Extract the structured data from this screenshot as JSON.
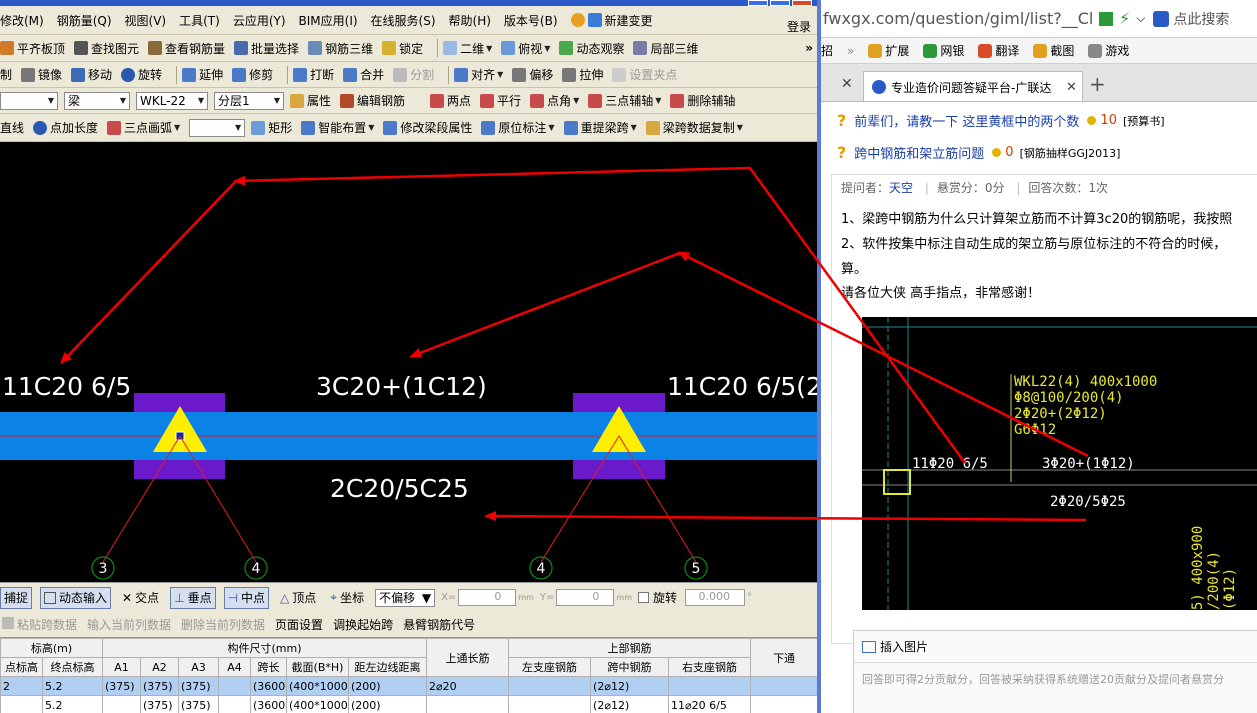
{
  "window": {
    "login": "登录"
  },
  "menu": [
    "修改(M)",
    "钢筋量(Q)",
    "视图(V)",
    "工具(T)",
    "云应用(Y)",
    "BIM应用(I)",
    "在线服务(S)",
    "帮助(H)",
    "版本号(B)",
    "新建变更"
  ],
  "toolbar1": [
    "平齐板顶",
    "查找图元",
    "查看钢筋量",
    "批量选择",
    "钢筋三维",
    "锁定",
    "二维",
    "俯视",
    "动态观察",
    "局部三维"
  ],
  "toolbar2": [
    "制",
    "镜像",
    "移动",
    "旋转",
    "延伸",
    "修剪",
    "打断",
    "合并",
    "分割",
    "对齐",
    "偏移",
    "拉伸",
    "设置夹点"
  ],
  "toolbar3": {
    "type": "梁",
    "member": "WKL-22",
    "layer": "分层1",
    "props": "属性",
    "edit": "编辑钢筋",
    "items": [
      "两点",
      "平行",
      "点角",
      "三点辅轴",
      "删除辅轴"
    ]
  },
  "toolbar4": [
    "直线",
    "点加长度",
    "三点画弧",
    "矩形",
    "智能布置",
    "修改梁段属性",
    "原位标注",
    "重提梁跨",
    "梁跨数据复制"
  ],
  "canvas": {
    "labels": [
      "11C20 6/5",
      "3C20+(1C12)",
      "11C20 6/5(2",
      "2C20/5C25"
    ],
    "axes": [
      "3",
      "4",
      "4",
      "5"
    ]
  },
  "status": {
    "items": [
      "捕捉",
      "动态输入",
      "交点",
      "垂点",
      "中点",
      "顶点",
      "坐标"
    ],
    "mode": "不偏移",
    "x_label": "X=",
    "x_val": "0",
    "y_label": "Y=",
    "y_val": "0",
    "unit": "mm",
    "rotate": "旋转",
    "angle": "0.000",
    "deg": "°"
  },
  "tabs": [
    "粘贴跨数据",
    "输入当前列数据",
    "删除当前列数据",
    "页面设置",
    "调换起始跨",
    "悬臂钢筋代号"
  ],
  "table": {
    "group_headers": [
      "标高(m)",
      "构件尺寸(mm)",
      "上通长筋",
      "上部钢筋"
    ],
    "headers": [
      "点标高",
      "终点标高",
      "A1",
      "A2",
      "A3",
      "A4",
      "跨长",
      "截面(B*H)",
      "距左边线距离",
      "",
      "左支座钢筋",
      "跨中钢筋",
      "右支座钢筋",
      "下通"
    ],
    "rows": [
      [
        "2",
        "5.2",
        "(375)",
        "(375)",
        "(375)",
        "",
        "(3600)",
        "(400*1000",
        "(200)",
        "2⌀20",
        "",
        "(2⌀12)",
        "",
        ""
      ],
      [
        "",
        "5.2",
        "",
        "(375)",
        "(375)",
        "",
        "(3600)",
        "(400*1000",
        "(200)",
        "",
        "",
        "(2⌀12)",
        "11⌀20 6/5",
        ""
      ]
    ]
  },
  "browser": {
    "url_domain": "fwxgx.com",
    "url_path": "/question/giml/list?__ClassCo",
    "search": "点此搜索",
    "bookmarks": [
      "招",
      "扩展",
      "网银",
      "翻译",
      "截图",
      "游戏"
    ],
    "tab_title": "专业造价问题答疑平台-广联达"
  },
  "qa": {
    "q1": {
      "title": "前辈们，请教一下 这里黄框中的两个数",
      "score": "10",
      "cat": "[预算书]"
    },
    "q2": {
      "title": "跨中钢筋和架立筋问题",
      "score": "0",
      "cat": "[钢筋抽样GGJ2013]"
    },
    "meta": {
      "asker_label": "提问者：",
      "asker": "天空",
      "reward": "悬赏分：0分",
      "answers": "回答次数：1次"
    },
    "body": [
      "1、梁跨中钢筋为什么只计算架立筋而不计算3c20的钢筋呢，我按照",
      "2、软件按集中标注自动生成的架立筋与原位标注的不符合的时候，",
      "算。",
      "请各位大侠 高手指点，非常感谢！"
    ],
    "cad": {
      "texts": [
        "WKL22(4) 400x1000",
        "Φ8@100/200(4)",
        "2Φ20+(2Φ12)",
        "G6Φ12",
        "11Φ20 6/5",
        "3Φ20+(1Φ12)",
        "2Φ20/5Φ25",
        "5) 400x900",
        "/200(4)",
        "(Φ12)"
      ]
    },
    "reply": {
      "insert": "插入图片",
      "placeholder": "回答即可得2分贡献分，回答被采纳获得系统赠送20贡献分及提问者悬赏分"
    }
  },
  "colors": {
    "beam": "#0a82e6",
    "support": "#6a1acb",
    "marker": "#ffee00",
    "arrow": "#ee0000",
    "axis": "#0c8a1c"
  }
}
